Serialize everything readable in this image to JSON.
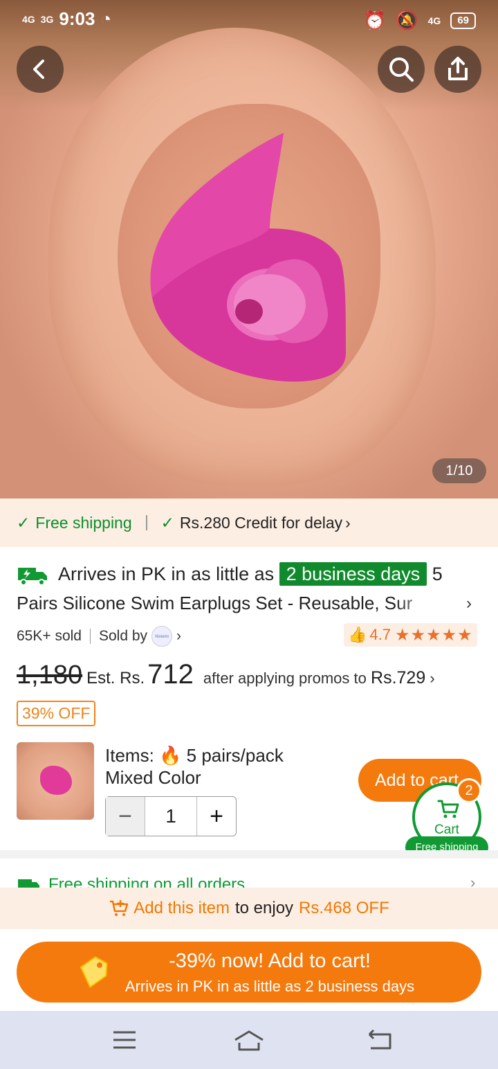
{
  "status_bar": {
    "network_left_1": "4G",
    "network_left_2": "3G",
    "time": "9:03",
    "network_right": "4G",
    "battery": "69"
  },
  "hero": {
    "image_counter": "1/10",
    "icons": [
      "back-icon",
      "search-icon",
      "share-icon"
    ]
  },
  "shipping_strip": {
    "free_shipping": "Free shipping",
    "credit": "Rs.280 Credit for delay",
    "credit_chevron": "›"
  },
  "product": {
    "arrive_prefix": "Arrives in PK in as little as",
    "arrive_badge": "2 business days",
    "title": "5 Pairs Silicone Swim Earplugs Set - Reusable, Sur",
    "title_first_word": "5",
    "title_rest": "Pairs Silicone Swim Earplugs Set - Reusable, Sur",
    "sold": "65K+ sold",
    "sold_by": "Sold by",
    "seller_logo_text": "Nixiemi",
    "rating": "4.7",
    "stars": "★★★★★",
    "old_price": "1,180",
    "est_label": "Est. Rs.",
    "price": "712",
    "promo_prefix": "after applying promos to",
    "promo_price": "Rs.729",
    "off_badge": "39% OFF",
    "items_label": "Items:",
    "items_value": "5 pairs/pack",
    "color": "Mixed Color",
    "quantity": "1",
    "minus": "−",
    "plus": "+",
    "add_to_cart": "Add to cart"
  },
  "cart": {
    "count": "2",
    "label": "Cart",
    "free_shipping": "Free shipping"
  },
  "free_row": {
    "text": "Free shipping on all orders",
    "chevron": "›"
  },
  "promo_bar": {
    "add_item": "Add this item",
    "to_enjoy": "to enjoy",
    "discount": "Rs.468 OFF"
  },
  "cta": {
    "line1": "-39% now! Add to cart!",
    "line2": "Arrives in PK in as little as 2 business days"
  },
  "colors": {
    "brand_orange": "#f47a0d",
    "green": "#119a33",
    "cream": "#fdeee3"
  }
}
